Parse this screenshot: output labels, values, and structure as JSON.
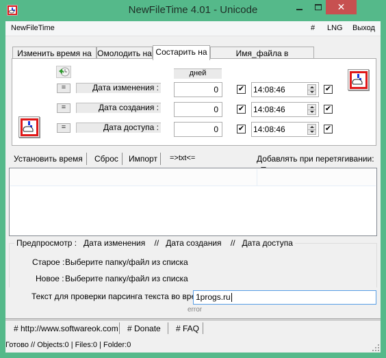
{
  "window": {
    "title": "NewFileTime 4.01 - Unicode",
    "close_glyph": "✕"
  },
  "menu": {
    "app_label": "NewFileTime",
    "hash_label": "#",
    "lng_label": "LNG",
    "exit_label": "Выход"
  },
  "tabs": [
    {
      "label": "Изменить время на",
      "active": false
    },
    {
      "label": "Омолодить на",
      "active": false
    },
    {
      "label": "Состарить на",
      "active": true
    },
    {
      "label": "Имя_файла в время_файла",
      "active": false
    }
  ],
  "panel": {
    "days_header": "дней",
    "equals_label": "=",
    "rows": [
      {
        "label": "Дата изменения :",
        "days": "0",
        "enabled_checked": true,
        "time": "14:08:46",
        "time_checked": true
      },
      {
        "label": "Дата создания :",
        "days": "0",
        "enabled_checked": true,
        "time": "14:08:46",
        "time_checked": true
      },
      {
        "label": "Дата доступа :",
        "days": "0",
        "enabled_checked": true,
        "time": "14:08:46",
        "time_checked": true
      }
    ],
    "check_glyph": "✔"
  },
  "toolbar": {
    "set_time": "Установить время",
    "reset": "Сброс",
    "import": "Импорт",
    "txt": "=>txt<=",
    "drag_add": "Добавлять при перетягивании:"
  },
  "preview": {
    "legend": "Предпросмотр :   Дата изменения    //   Дата создания    //   Дата доступа",
    "old_label": "Старое :",
    "old_value": "Выберите папку/файл из списка",
    "new_label": "Новое :",
    "new_value": "Выберите папку/файл из списка"
  },
  "parse": {
    "label": "Текст для проверки парсинга текста во время",
    "value": "1progs.ru",
    "error": "error"
  },
  "links": {
    "website": "# http://www.softwareok.com",
    "donate": "# Donate",
    "faq": "# FAQ"
  },
  "status": {
    "text": "Готово // Objects:0 | Files:0  | Folder:0"
  }
}
